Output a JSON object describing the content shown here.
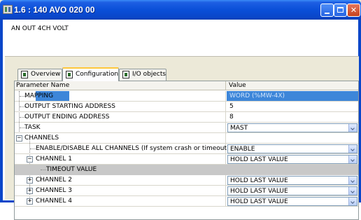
{
  "window": {
    "title": "1.6 : 140 AVO 020 00"
  },
  "module": {
    "description": "AN OUT 4CH VOLT"
  },
  "tabs": [
    {
      "label": "Overview"
    },
    {
      "label": "Configuration"
    },
    {
      "label": "I/O objects"
    }
  ],
  "grid": {
    "headers": {
      "name": "Parameter Name",
      "value": "Value"
    },
    "rows": [
      {
        "name": "MAPPING",
        "value": "WORD (%MW-4X)"
      },
      {
        "name": "OUTPUT STARTING ADDRESS",
        "value": "5"
      },
      {
        "name": "OUTPUT ENDING ADDRESS",
        "value": "8"
      },
      {
        "name": "TASK",
        "value": "MAST"
      },
      {
        "name": "CHANNELS",
        "value": ""
      },
      {
        "name": "ENABLE/DISABLE ALL CHANNELS (If system crash or timeout)",
        "value": "ENABLE"
      },
      {
        "name": "CHANNEL 1",
        "value": "HOLD LAST VALUE"
      },
      {
        "name": "TIMEOUT VALUE",
        "value": ""
      },
      {
        "name": "CHANNEL 2",
        "value": "HOLD LAST VALUE"
      },
      {
        "name": "CHANNEL 3",
        "value": "HOLD LAST VALUE"
      },
      {
        "name": "CHANNEL 4",
        "value": "HOLD LAST VALUE"
      }
    ]
  },
  "colors": {
    "titlebar": "#0a4fd8",
    "selection": "#3d86d9",
    "active_tab_accent": "#ffc83c"
  }
}
